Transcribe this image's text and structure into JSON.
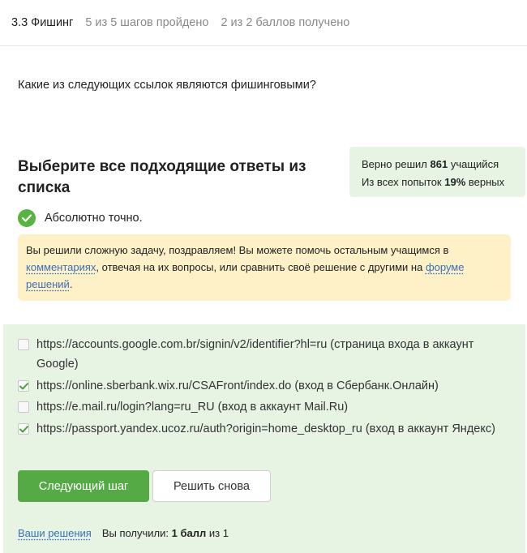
{
  "header": {
    "lesson_title": "3.3 Фишинг",
    "steps_progress": "5 из 5 шагов пройдено",
    "score_progress": "2 из 2 баллов  получено"
  },
  "question": "Какие из следующих ссылок являются фишинговыми?",
  "section_title": "Выберите все подходящие ответы из списка",
  "stats": {
    "solved_prefix": "Верно решил",
    "solved_count": "861",
    "solved_suffix": "учащийся",
    "attempts_prefix": "Из всех попыток",
    "attempts_percent": "19%",
    "attempts_suffix": "верных"
  },
  "status": {
    "text": "Абсолютно точно.",
    "color": "#59b343"
  },
  "notice": {
    "text_1": "Вы решили сложную задачу, поздравляем! Вы можете помочь остальным учащимся в ",
    "link_comments": "комментариях",
    "text_2": ", отвечая на их вопросы, или сравнить своё решение с другими на ",
    "link_forum": "форуме решений",
    "text_3": "."
  },
  "options": [
    {
      "text": "https://accounts.google.com.br/signin/v2/identifier?hl=ru (страница входа в аккаунт Google)",
      "checked": false
    },
    {
      "text": "https://online.sberbank.wix.ru/CSAFront/index.do (вход в Сбербанк.Онлайн)",
      "checked": true
    },
    {
      "text": "https://e.mail.ru/login?lang=ru_RU (вход в аккаунт Mail.Ru)",
      "checked": false
    },
    {
      "text": "https://passport.yandex.ucoz.ru/auth?origin=home_desktop_ru (вход в аккаунт Яндекс)",
      "checked": true
    }
  ],
  "buttons": {
    "next": "Следующий шаг",
    "retry": "Решить снова"
  },
  "footer": {
    "solutions_link": "Ваши решения",
    "received_prefix": "Вы получили:",
    "received_points": "1 балл",
    "received_suffix": "из 1"
  },
  "colors": {
    "accent_green": "#55aa45",
    "panel_green": "#e7f4e4",
    "notice_yellow": "#fef1c8",
    "link_blue": "#3870b8"
  }
}
